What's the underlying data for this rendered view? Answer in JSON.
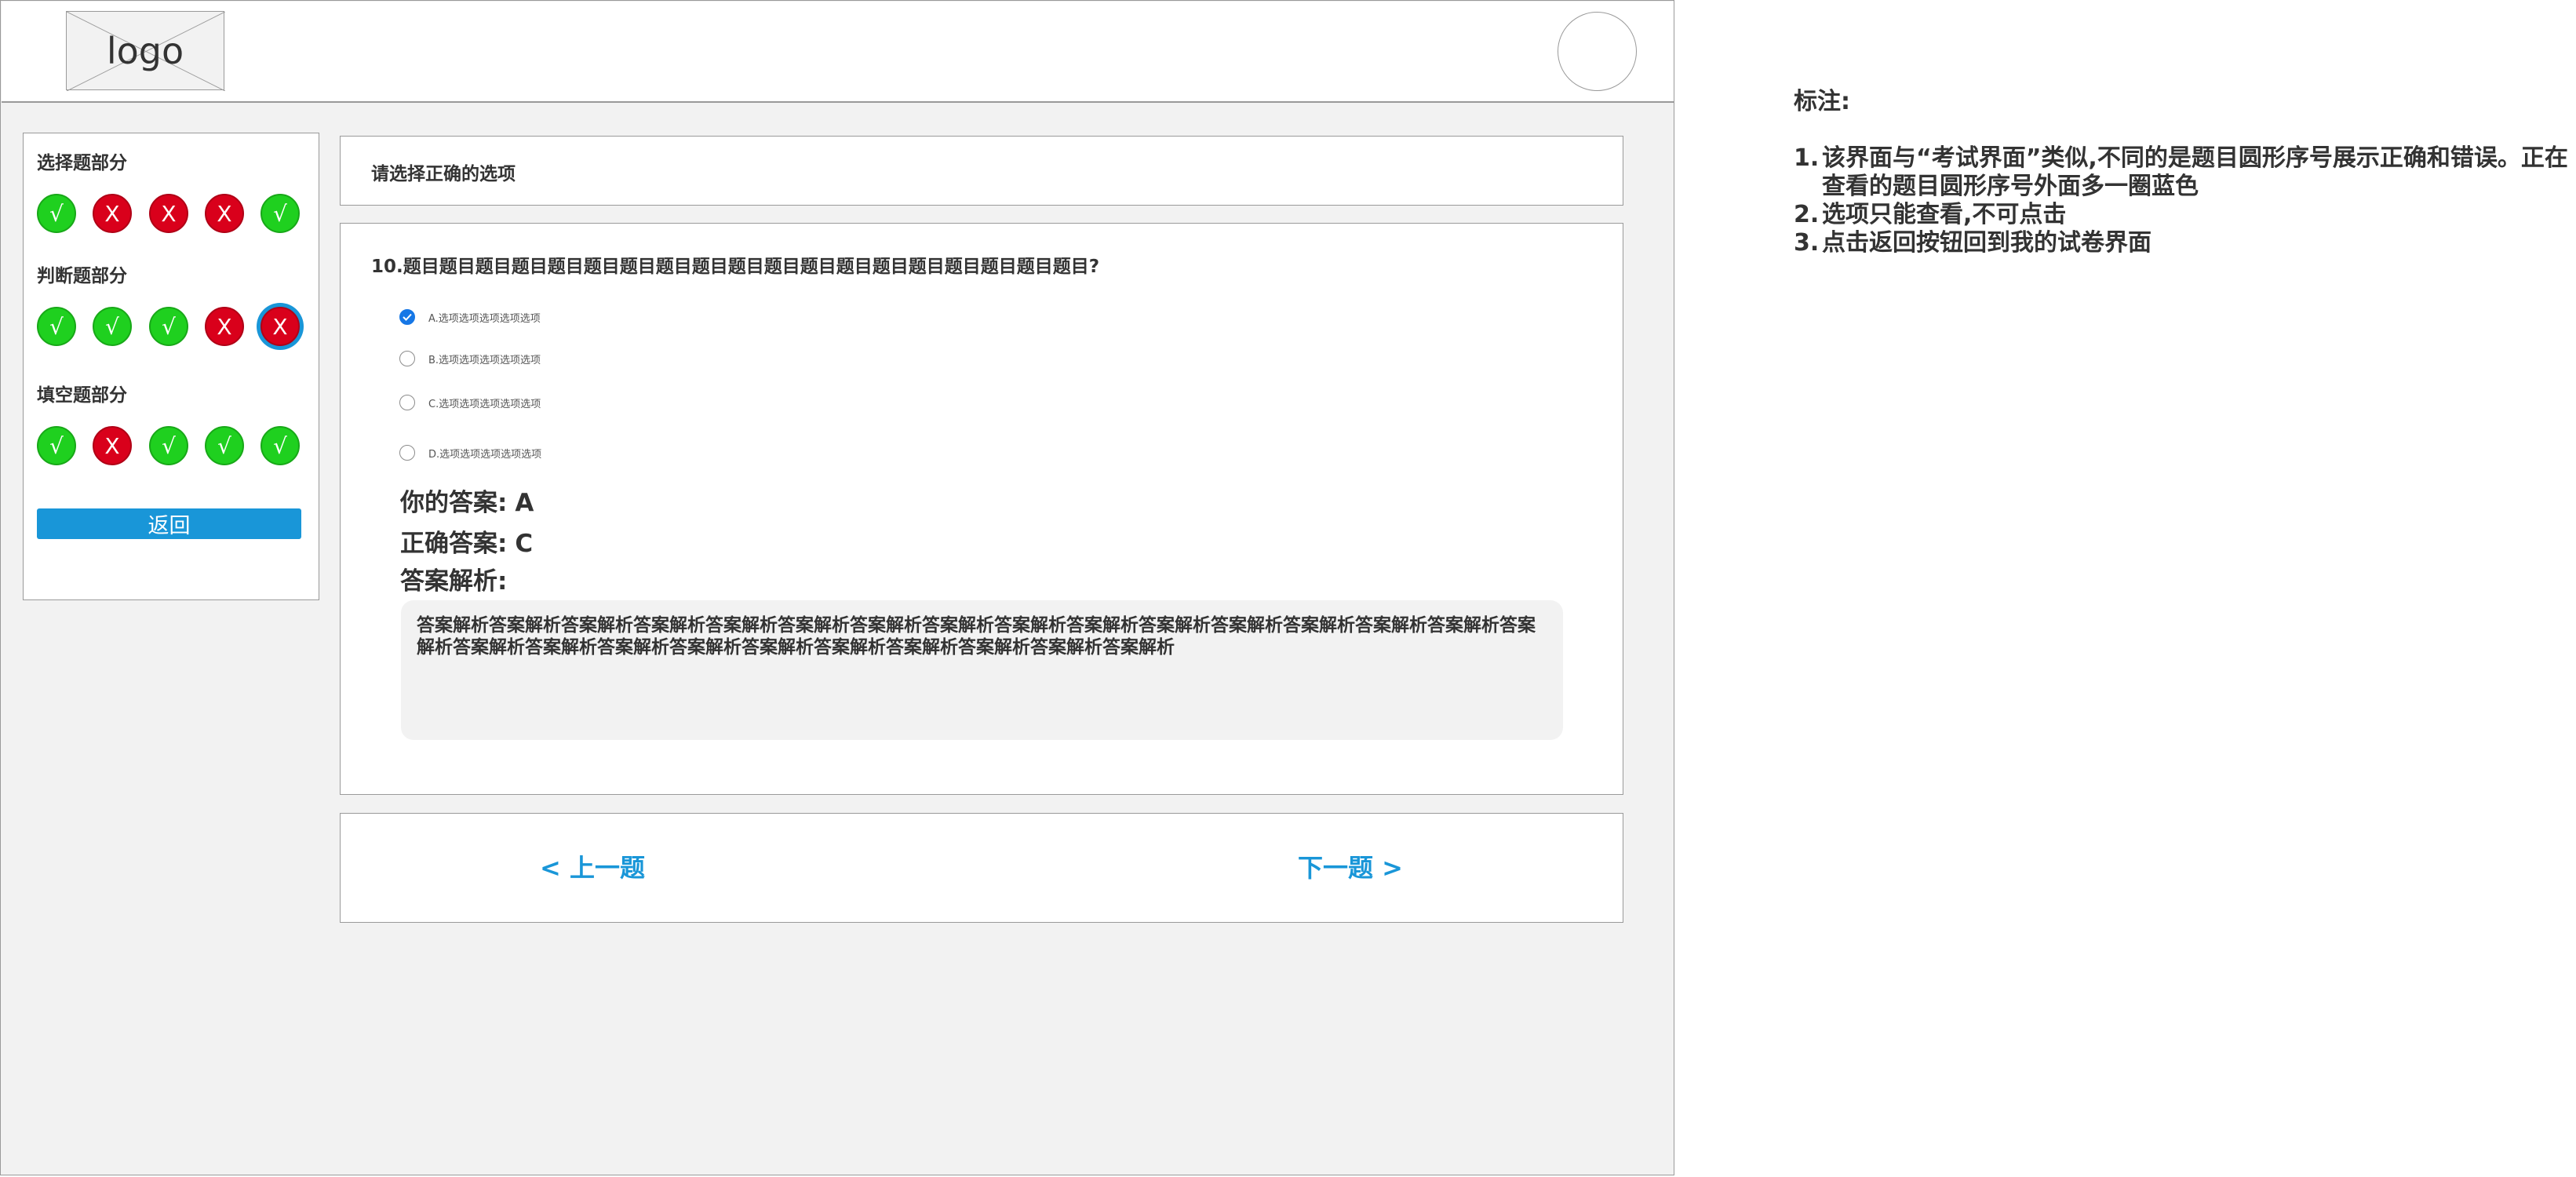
{
  "header": {
    "logo_text": "logo"
  },
  "sidebar": {
    "sections": [
      {
        "title": "选择题部分",
        "items": [
          {
            "mark": "√",
            "status": "correct"
          },
          {
            "mark": "X",
            "status": "wrong"
          },
          {
            "mark": "X",
            "status": "wrong"
          },
          {
            "mark": "X",
            "status": "wrong"
          },
          {
            "mark": "√",
            "status": "correct"
          }
        ]
      },
      {
        "title": "判断题部分",
        "items": [
          {
            "mark": "√",
            "status": "correct"
          },
          {
            "mark": "√",
            "status": "correct"
          },
          {
            "mark": "√",
            "status": "correct"
          },
          {
            "mark": "X",
            "status": "wrong"
          },
          {
            "mark": "X",
            "status": "wrong",
            "current": true
          }
        ]
      },
      {
        "title": "填空题部分",
        "items": [
          {
            "mark": "√",
            "status": "correct"
          },
          {
            "mark": "X",
            "status": "wrong"
          },
          {
            "mark": "√",
            "status": "correct"
          },
          {
            "mark": "√",
            "status": "correct"
          },
          {
            "mark": "√",
            "status": "correct"
          }
        ]
      }
    ],
    "back_label": "返回"
  },
  "main": {
    "instruction": "请选择正确的选项",
    "question": "10.题目题目题目题目题目题目题目题目题目题目题目题目题目题目题目题目题目题目题目?",
    "options": [
      {
        "label": "A.选项选项选项选项选项",
        "selected": true
      },
      {
        "label": "B.选项选项选项选项选项",
        "selected": false
      },
      {
        "label": "C.选项选项选项选项选项",
        "selected": false
      },
      {
        "label": "D.选项选项选项选项选项",
        "selected": false
      }
    ],
    "your_answer_label": "你的答案:",
    "your_answer": "A",
    "correct_answer_label": "正确答案:",
    "correct_answer": "C",
    "analysis_label": "答案解析:",
    "analysis_text": "答案解析答案解析答案解析答案解析答案解析答案解析答案解析答案解析答案解析答案解析答案解析答案解析答案解析答案解析答案解析答案解析答案解析答案解析答案解析答案解析答案解析答案解析答案解析答案解析答案解析答案解析"
  },
  "nav": {
    "prev_label": "<  上一题",
    "next_label": "下一题  >"
  },
  "notes": {
    "title": "标注:",
    "items": [
      {
        "num": "1.",
        "text": "该界面与“考试界面”类似,不同的是题目圆形序号展示正确和错误。正在查看的题目圆形序号外面多一圈蓝色"
      },
      {
        "num": "2.",
        "text": "选项只能查看,不可点击"
      },
      {
        "num": "3.",
        "text": "点击返回按钮回到我的试卷界面"
      }
    ]
  },
  "colors": {
    "correct": "#1fd01f",
    "wrong": "#d9001b",
    "current_ring": "#1996d8",
    "primary": "#1996d8",
    "radio_checked": "#1677e6"
  }
}
